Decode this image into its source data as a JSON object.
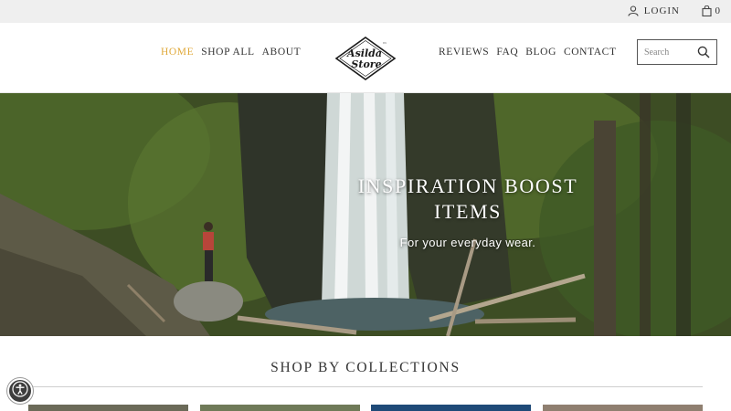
{
  "topbar": {
    "login_label": "LOGIN",
    "cart_count": "0",
    "login_icon": "user-icon",
    "cart_icon": "shopping-bag-icon"
  },
  "nav": {
    "left": [
      {
        "label": "HOME",
        "active": true
      },
      {
        "label": "SHOP ALL",
        "active": false
      },
      {
        "label": "ABOUT",
        "active": false
      }
    ],
    "right": [
      {
        "label": "REVIEWS"
      },
      {
        "label": "FAQ"
      },
      {
        "label": "BLOG"
      },
      {
        "label": "CONTACT"
      }
    ],
    "active_color": "#e0a93a"
  },
  "logo": {
    "line1": "Asilda",
    "line2": "Store",
    "tm": "™"
  },
  "search": {
    "placeholder": "Search",
    "icon": "search-icon"
  },
  "hero": {
    "title": "INSPIRATION BOOST ITEMS",
    "subtitle": "For your everyday wear."
  },
  "collections": {
    "title": "SHOP BY COLLECTIONS",
    "tile_colors": [
      "#6b6a58",
      "#6f7a58",
      "#1f4a78",
      "#8f7f70"
    ]
  },
  "accessibility": {
    "icon": "accessibility-icon"
  }
}
